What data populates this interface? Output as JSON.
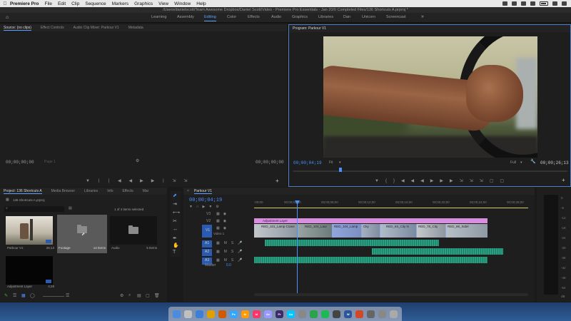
{
  "menubar": {
    "app_name": "Premiere Pro",
    "items": [
      "File",
      "Edit",
      "Clip",
      "Sequence",
      "Markers",
      "Graphics",
      "View",
      "Window",
      "Help"
    ]
  },
  "window": {
    "title": "/Users/danielscott/Team Awesome Dropbox/Daniel Scott/Video - Premiere Pro Essentials - Jan 20/0 Completed Files/136 Shortcuts A.prproj *"
  },
  "workspaces": {
    "items": [
      "Learning",
      "Assembly",
      "Editing",
      "Color",
      "Effects",
      "Audio",
      "Graphics",
      "Libraries",
      "Dan",
      "Unicorn",
      "Screencast"
    ],
    "active": "Editing"
  },
  "source_panel": {
    "tabs": [
      "Source: (no clips)",
      "Effect Controls",
      "Audio Clip Mixer: Parkour V1",
      "Metadata"
    ],
    "timecode_in": "00;00;00;00",
    "timecode_out": "00;00;00;00",
    "fit_label": "Page 1"
  },
  "program_panel": {
    "tab": "Program: Parkour V1",
    "timecode": "00;00;04;19",
    "fit": "Fit",
    "quality": "Full",
    "duration": "00;00;26;13"
  },
  "project_panel": {
    "tabs": [
      "Project: 136 Shortcuts A",
      "Media Browser",
      "Libraries",
      "Info",
      "Effects",
      "Mar"
    ],
    "project_file": "136 Shortcuts A.prproj",
    "selection_status": "1 of 4 items selected",
    "items": [
      {
        "name": "Parkour V1",
        "meta": "26;13"
      },
      {
        "name": "Footage",
        "meta": "14 Items"
      },
      {
        "name": "Audio",
        "meta": "5 Items"
      },
      {
        "name": "Adjustment Layer",
        "meta": "4;29"
      }
    ]
  },
  "timeline": {
    "tab": "Parkour V1",
    "timecode": "00;00;04;19",
    "ruler": [
      ":00;00",
      "00;00;04;00",
      "00;00;08;00",
      "00;00;12;00",
      "00;00;16;00",
      "00;00;20;00",
      "00;00;24;00",
      "00;00;28;00"
    ],
    "tracks": {
      "v_labels": [
        "V3",
        "V2",
        "V1"
      ],
      "a_labels": [
        "A1",
        "A2",
        "A3"
      ],
      "video_name": "Video 1",
      "master_label": "Master",
      "master_value": "0.0"
    },
    "clips": {
      "adjustment": "Adjustment Layer",
      "v1": [
        "RED_101_Lamp Crane",
        "RED_103_Laur",
        "RED_104_Lamp",
        "Cky",
        "RED_84_City N",
        "RED_78_City",
        "RED_88_Sidel"
      ]
    }
  },
  "meters": {
    "scale": [
      "0",
      "-6",
      "-12",
      "-18",
      "-24",
      "-30",
      "-36",
      "-42",
      "-48",
      "-54",
      "dB"
    ]
  },
  "colors": {
    "accent": "#4a90ff",
    "adjustment_clip": "#d88fe0",
    "video_clip": "#8fa6de",
    "audio_clip": "#2aa082"
  }
}
